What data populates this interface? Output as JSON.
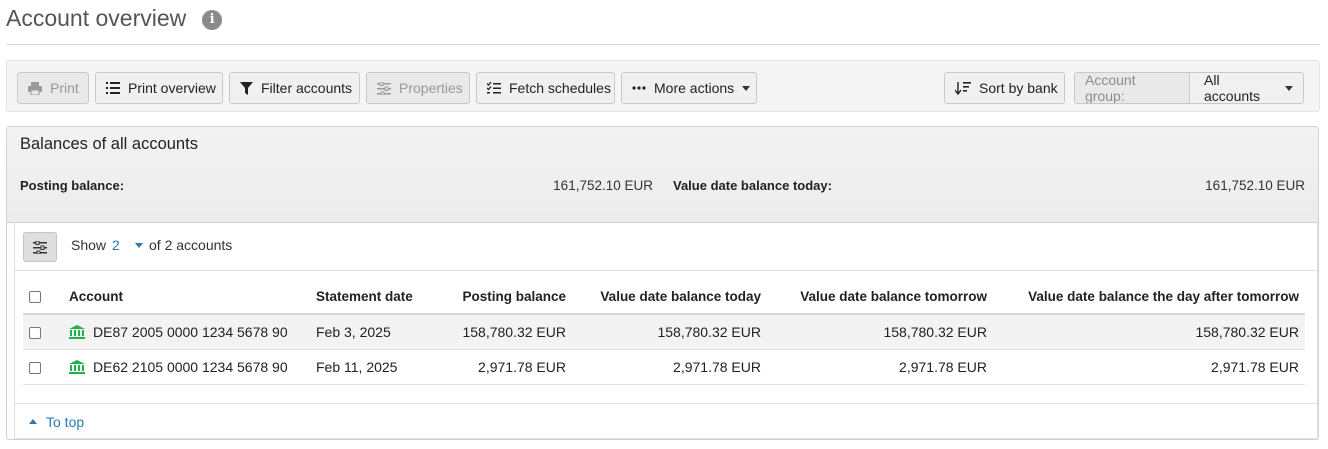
{
  "header": {
    "title": "Account overview",
    "info_icon": "info-icon"
  },
  "toolbar": {
    "print": "Print",
    "print_overview": "Print overview",
    "filter_accounts": "Filter accounts",
    "properties": "Properties",
    "fetch_schedules": "Fetch schedules",
    "more_actions": "More actions",
    "sort_by_bank": "Sort by bank",
    "account_group_label": "Account group:",
    "account_group_value": "All accounts"
  },
  "balances": {
    "title": "Balances of all accounts",
    "posting_label": "Posting balance:",
    "posting_value": "161,752.10 EUR",
    "value_date_label": "Value date balance today:",
    "value_date_value": "161,752.10 EUR"
  },
  "show": {
    "prefix": "Show",
    "count": "2",
    "suffix": "of 2 accounts"
  },
  "table": {
    "headers": [
      "Account",
      "Statement date",
      "Posting balance",
      "Value date balance today",
      "Value date balance tomorrow",
      "Value date balance the day after tomorrow"
    ],
    "rows": [
      {
        "account": "DE87 2005 0000 1234 5678 90",
        "statement_date": "Feb 3, 2025",
        "posting": "158,780.32 EUR",
        "today": "158,780.32 EUR",
        "tomorrow": "158,780.32 EUR",
        "day_after": "158,780.32 EUR"
      },
      {
        "account": "DE62 2105 0000 1234 5678 90",
        "statement_date": "Feb 11, 2025",
        "posting": "2,971.78 EUR",
        "today": "2,971.78 EUR",
        "tomorrow": "2,971.78 EUR",
        "day_after": "2,971.78 EUR"
      }
    ]
  },
  "footer": {
    "to_top": "To top"
  },
  "colors": {
    "link": "#2a7ab0",
    "bank_icon": "#22b14c",
    "disabled_text": "#9a9a9a"
  }
}
